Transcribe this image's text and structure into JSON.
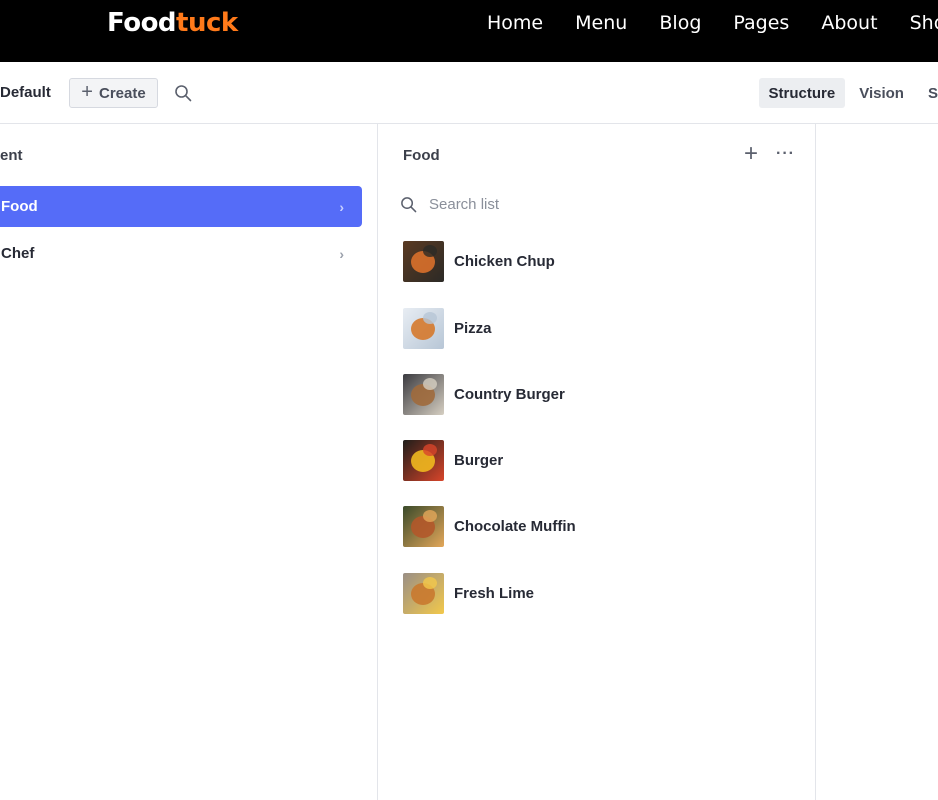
{
  "site": {
    "brand_part1": "Food",
    "brand_part2": "tuck",
    "nav": [
      "Home",
      "Menu",
      "Blog",
      "Pages",
      "About",
      "Shop"
    ],
    "brand_accent_color": "#ff7a1a"
  },
  "toolbar": {
    "workspace": "Default",
    "create_label": "Create",
    "search_icon": "search-icon",
    "tools": [
      {
        "label": "Structure",
        "active": true
      },
      {
        "label": "Vision",
        "active": false
      },
      {
        "label": "S",
        "active": false
      }
    ]
  },
  "left_pane": {
    "title": "ent",
    "items": [
      {
        "label": "Food",
        "selected": true,
        "icon": "chevron-right-icon"
      },
      {
        "label": "Chef",
        "selected": false,
        "icon": "chevron-right-icon"
      }
    ],
    "selected_color": "#556cf8"
  },
  "list_pane": {
    "title": "Food",
    "add_icon": "plus-icon",
    "menu_icon": "more-dots-icon",
    "search_placeholder": "Search list",
    "items": [
      {
        "title": "Chicken Chup",
        "thumb_colors": [
          "#5a3a22",
          "#d9702b",
          "#2c2a26"
        ]
      },
      {
        "title": "Pizza",
        "thumb_colors": [
          "#e8edf3",
          "#d5792c",
          "#b7c6d6"
        ]
      },
      {
        "title": "Country Burger",
        "thumb_colors": [
          "#3b3b40",
          "#a06a3c",
          "#d6cfc2"
        ]
      },
      {
        "title": "Burger",
        "thumb_colors": [
          "#1f1d1a",
          "#f0b81f",
          "#d8452a"
        ]
      },
      {
        "title": "Chocolate Muffin",
        "thumb_colors": [
          "#3a4a2a",
          "#b3582a",
          "#e3a75a"
        ]
      },
      {
        "title": "Fresh Lime",
        "thumb_colors": [
          "#9a8f86",
          "#c9792f",
          "#f2c84b"
        ]
      }
    ]
  }
}
